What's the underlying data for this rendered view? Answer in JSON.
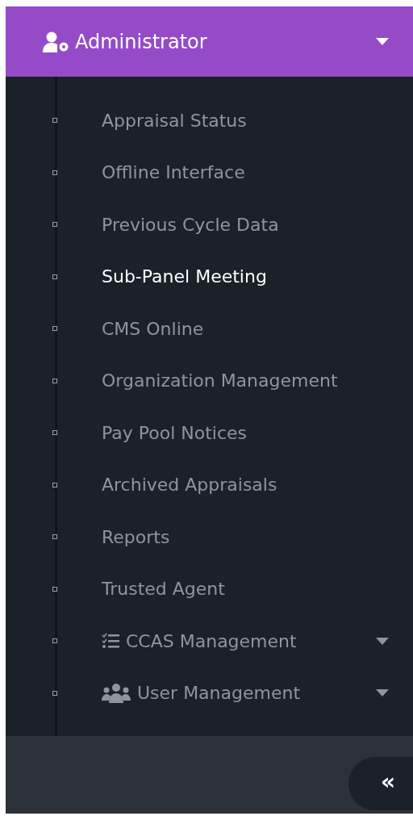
{
  "header": {
    "title": "Administrator",
    "expanded": true
  },
  "items": [
    {
      "label": "Appraisal Status",
      "kind": "link",
      "selected": false
    },
    {
      "label": "Offline Interface",
      "kind": "link",
      "selected": false
    },
    {
      "label": "Previous Cycle Data",
      "kind": "link",
      "selected": false
    },
    {
      "label": "Sub-Panel Meeting",
      "kind": "link",
      "selected": true
    },
    {
      "label": "CMS Online",
      "kind": "link",
      "selected": false
    },
    {
      "label": "Organization Management",
      "kind": "link",
      "selected": false
    },
    {
      "label": "Pay Pool Notices",
      "kind": "link",
      "selected": false
    },
    {
      "label": "Archived Appraisals",
      "kind": "link",
      "selected": false
    },
    {
      "label": "Reports",
      "kind": "link",
      "selected": false
    },
    {
      "label": "Trusted Agent",
      "kind": "link",
      "selected": false
    },
    {
      "label": "CCAS Management",
      "kind": "checklist-group",
      "selected": false
    },
    {
      "label": "User Management",
      "kind": "users-group",
      "selected": false
    }
  ],
  "collapse_button": {
    "label": "«"
  }
}
